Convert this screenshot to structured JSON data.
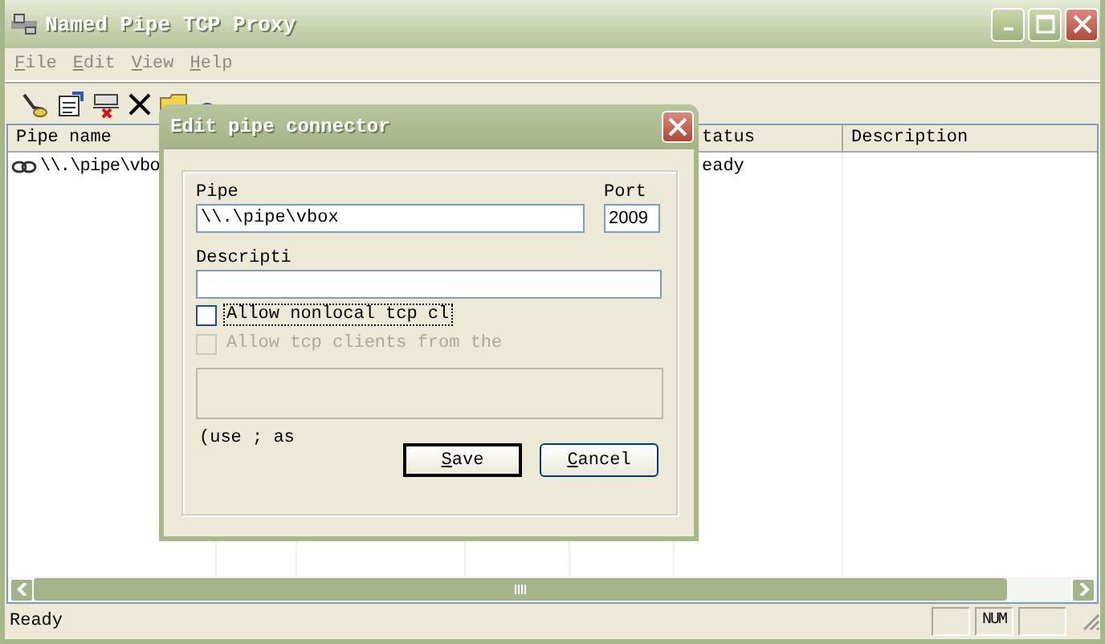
{
  "window": {
    "title": "Named Pipe TCP Proxy"
  },
  "menu": [
    {
      "label": "File"
    },
    {
      "label": "Edit"
    },
    {
      "label": "View"
    },
    {
      "label": "Help"
    }
  ],
  "table": {
    "columns": [
      "Pipe name",
      "tatus",
      "Description"
    ],
    "rows": [
      {
        "pipe_name": "\\\\.\\pipe\\vbo",
        "status": "eady"
      }
    ]
  },
  "status_bar": {
    "text": "Ready",
    "indicator": "NUM"
  },
  "dialog": {
    "title": "Edit pipe connector",
    "pipe": {
      "label": "Pipe",
      "value": "\\\\.\\pipe\\vbox"
    },
    "port": {
      "label": "Port",
      "value": "2009"
    },
    "description": {
      "label": "Descripti"
    },
    "checkboxes": [
      {
        "label": "Allow nonlocal tcp cl",
        "checked": false,
        "disabled": false,
        "focused": true
      },
      {
        "label": "Allow tcp clients from the",
        "checked": false,
        "disabled": true,
        "focused": false
      }
    ],
    "hint": "(use ; as",
    "buttons": [
      {
        "label": "Save",
        "default": true
      },
      {
        "label": "Cancel",
        "default": false
      }
    ]
  }
}
